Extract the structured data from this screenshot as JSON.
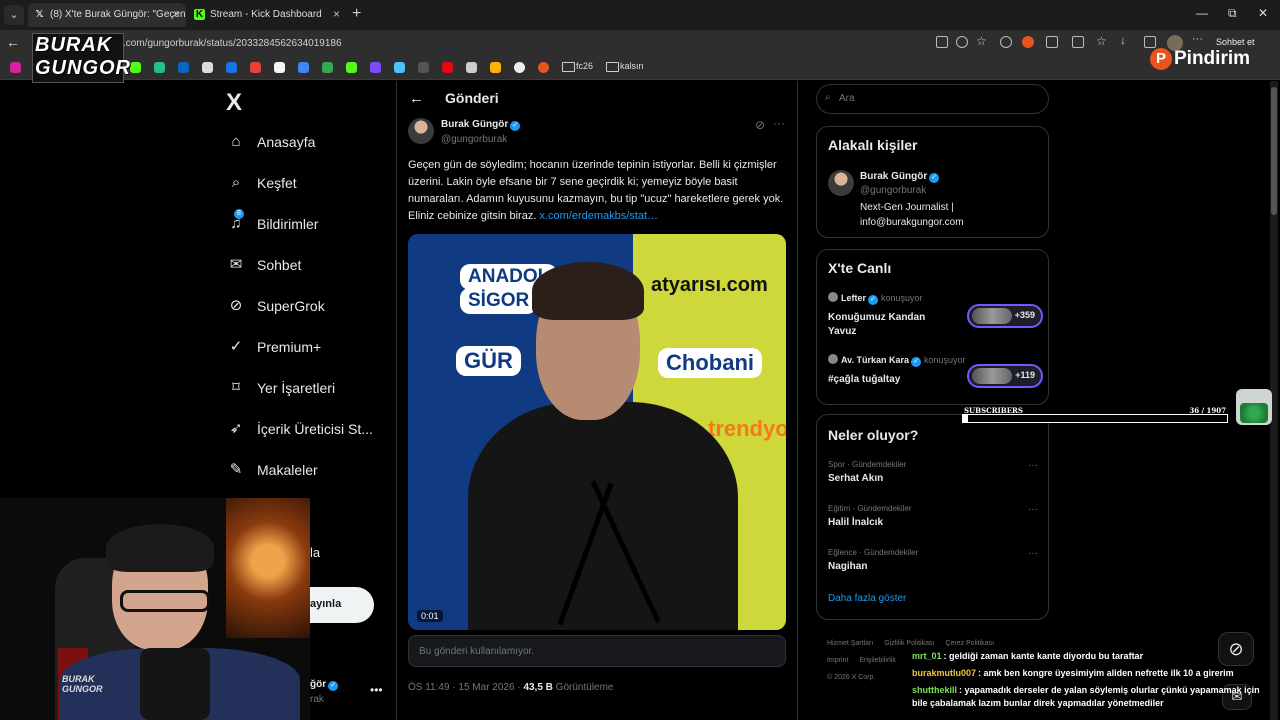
{
  "browser": {
    "tabs": [
      {
        "title": "(8) X'te Burak Güngör: \"Geçen gün",
        "favicon": "x-logo",
        "active": true
      },
      {
        "title": "Stream - Kick Dashboard",
        "favicon": "kick-logo",
        "active": false
      }
    ],
    "new_tab": "+",
    "url": "x.com/gungorburak/status/2033284562634019186",
    "copilot_label": "Sohbet et",
    "bookmark_folders": [
      "fc26",
      "kalsın"
    ],
    "window_controls": [
      "—",
      "⧉",
      "✕"
    ]
  },
  "overlay": {
    "logo_line1": "BURAK",
    "logo_line2": "GUNGOR",
    "sponsor": "Pindirim",
    "sponsor_initial": "P",
    "subscribers_label": "SUBSCRIBERS",
    "subscribers_count": "36  / 1907",
    "subscribers_progress": 0.0189,
    "cam_logo_line1": "BURAK",
    "cam_logo_line2": "GUNGOR"
  },
  "leftnav": {
    "logo": "X",
    "items": [
      {
        "label": "Anasayfa",
        "icon": "home-icon"
      },
      {
        "label": "Keşfet",
        "icon": "search-icon"
      },
      {
        "label": "Bildirimler",
        "icon": "bell-icon",
        "badge": "8"
      },
      {
        "label": "Sohbet",
        "icon": "mail-icon"
      },
      {
        "label": "SuperGrok",
        "icon": "grok-icon"
      },
      {
        "label": "Premium+",
        "icon": "premium-icon"
      },
      {
        "label": "Yer İşaretleri",
        "icon": "bookmark-icon"
      },
      {
        "label": "İçerik Üreticisi St...",
        "icon": "rocket-icon"
      },
      {
        "label": "Makaleler",
        "icon": "article-icon"
      }
    ],
    "partial_item": "la",
    "publish_partial": "ayınla",
    "profile_name_partial": "ğör",
    "profile_handle_partial": "rak",
    "more": "•••"
  },
  "post": {
    "header": "Gönderi",
    "author_name": "Burak Güngör",
    "author_handle": "@gungorburak",
    "text": "Geçen gün de söyledim; hocanın üzerinde tepinin istiyorlar. Belli ki çizmişler üzerini. Lakin öyle efsane bir 7 sene geçirdik ki; yemeyiz böyle basit numaraları. Adamın kuyusunu kazmayın, bu tip \"ucuz\" hareketlere gerek yok. Eliniz cebinize gitsin biraz. ",
    "link": "x.com/erdemakbs/stat…",
    "video_time": "0:01",
    "video_sponsors": [
      "ANADOL",
      "SİGOR",
      "atyarısı.com",
      "GÜR",
      "Chobani",
      "trendyo"
    ],
    "unavailable": "Bu gönderi kullanılamıyor.",
    "meta_time": "ÖS 11:49 · 15 Mar 2026 · ",
    "meta_views": "43,5 B",
    "meta_views_label": " Görüntüleme"
  },
  "right": {
    "search_placeholder": "Ara",
    "related": {
      "title": "Alakalı kişiler",
      "name": "Burak Güngör",
      "handle": "@gungorburak",
      "bio_line1": "Next-Gen Journalist |",
      "bio_line2": "info@burakgungor.com"
    },
    "live": {
      "title": "X'te Canlı",
      "items": [
        {
          "host": "Lefter",
          "status": "konuşuyor",
          "title": "Konuğumuz Kandan Yavuz",
          "count": "+359"
        },
        {
          "host": "Av. Türkan Kara",
          "status": "konuşuyor",
          "title": "#çağla tuğaltay",
          "count": "+119"
        }
      ]
    },
    "trends": {
      "title": "Neler oluyor?",
      "items": [
        {
          "category": "Spor · Gündemdekiler",
          "name": "Serhat Akın"
        },
        {
          "category": "Eğitim · Gündemdekiler",
          "name": "Halil İnalcık"
        },
        {
          "category": "Eğlence · Gündemdekiler",
          "name": "Nagihan"
        }
      ],
      "show_more": "Daha fazla göster"
    },
    "footer": [
      "Hizmet Şartları",
      "Gizlilik Politikası",
      "Çerez Politikası",
      "Imprint",
      "Erişilebilirlik",
      "© 2026 X Corp."
    ]
  },
  "chat": [
    {
      "user": "mrt_01",
      "color": "#7be05a",
      "message": ": geldiği zaman kante kante diyordu bu taraftar"
    },
    {
      "user": "burakmutlu007",
      "color": "#f5c542",
      "message": ": amk ben kongre üyesimiyim aliden nefrette ilk 10 a girerim"
    },
    {
      "user": "shutthekill",
      "color": "#7be05a",
      "message": ": yapamadık derseler de yalan söylemiş olurlar çünkü yapamamak için bile çabalamak lazım bunlar direk yapmadılar yönetmediler"
    }
  ],
  "colors": {
    "accent": "#1d9bf0",
    "background": "#000000",
    "border": "#2f3336",
    "muted": "#71767b",
    "live_ring": "#7856ff"
  }
}
